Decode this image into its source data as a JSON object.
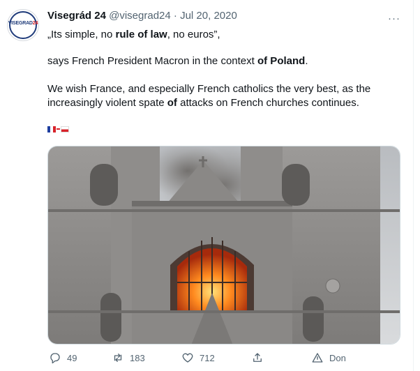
{
  "author": {
    "name": "Visegrád 24",
    "handle": "@visegrad24",
    "separator": "·",
    "date": "Jul 20, 2020",
    "avatar_text": "VISEGRAD",
    "avatar_text_accent": "24"
  },
  "tweet": {
    "line1_a": "„Its simple, no ",
    "line1_b": "rule of law",
    "line1_c": ", no euros”,",
    "line2_a": "says French President Macron in the context ",
    "line2_b": "of Poland",
    "line2_c": ".",
    "line3_a": "We wish France, and especially French catholics the very best, as the increasingly violent spate ",
    "line3_b": "of",
    "line3_c": " attacks on French churches continues.",
    "flags": [
      "france-flag-icon",
      "poland-flag-icon"
    ]
  },
  "media": {
    "description_icon": "cathedral-fire-photo"
  },
  "actions": {
    "replies": "49",
    "retweets": "183",
    "likes": "712",
    "translate_label": "Don"
  },
  "colors": {
    "text": "#0f1419",
    "muted": "#536471",
    "border": "#cfd9de",
    "brand_blue": "#1f3b7a",
    "brand_red": "#d8232a"
  }
}
